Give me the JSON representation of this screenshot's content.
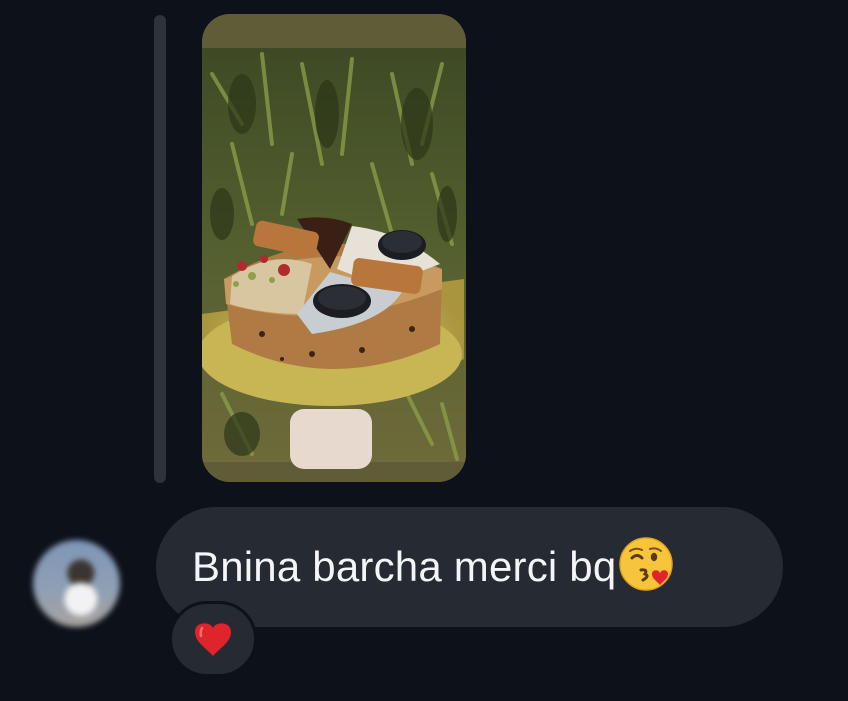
{
  "conversation": {
    "shared_post": {
      "icon": "cake-photo-thumbnail"
    },
    "message": {
      "text": "Bnina barcha merci bq",
      "emoji_icon": "kissing-face-with-heart-emoji"
    },
    "reaction": {
      "icon": "red-heart-emoji"
    },
    "sender_avatar": {
      "icon": "blurred-avatar"
    }
  },
  "colors": {
    "background": "#0d111a",
    "bubble": "#262a33",
    "reply_bar": "#2e333b",
    "text": "#f4f5f7",
    "heart": "#e0242c"
  }
}
